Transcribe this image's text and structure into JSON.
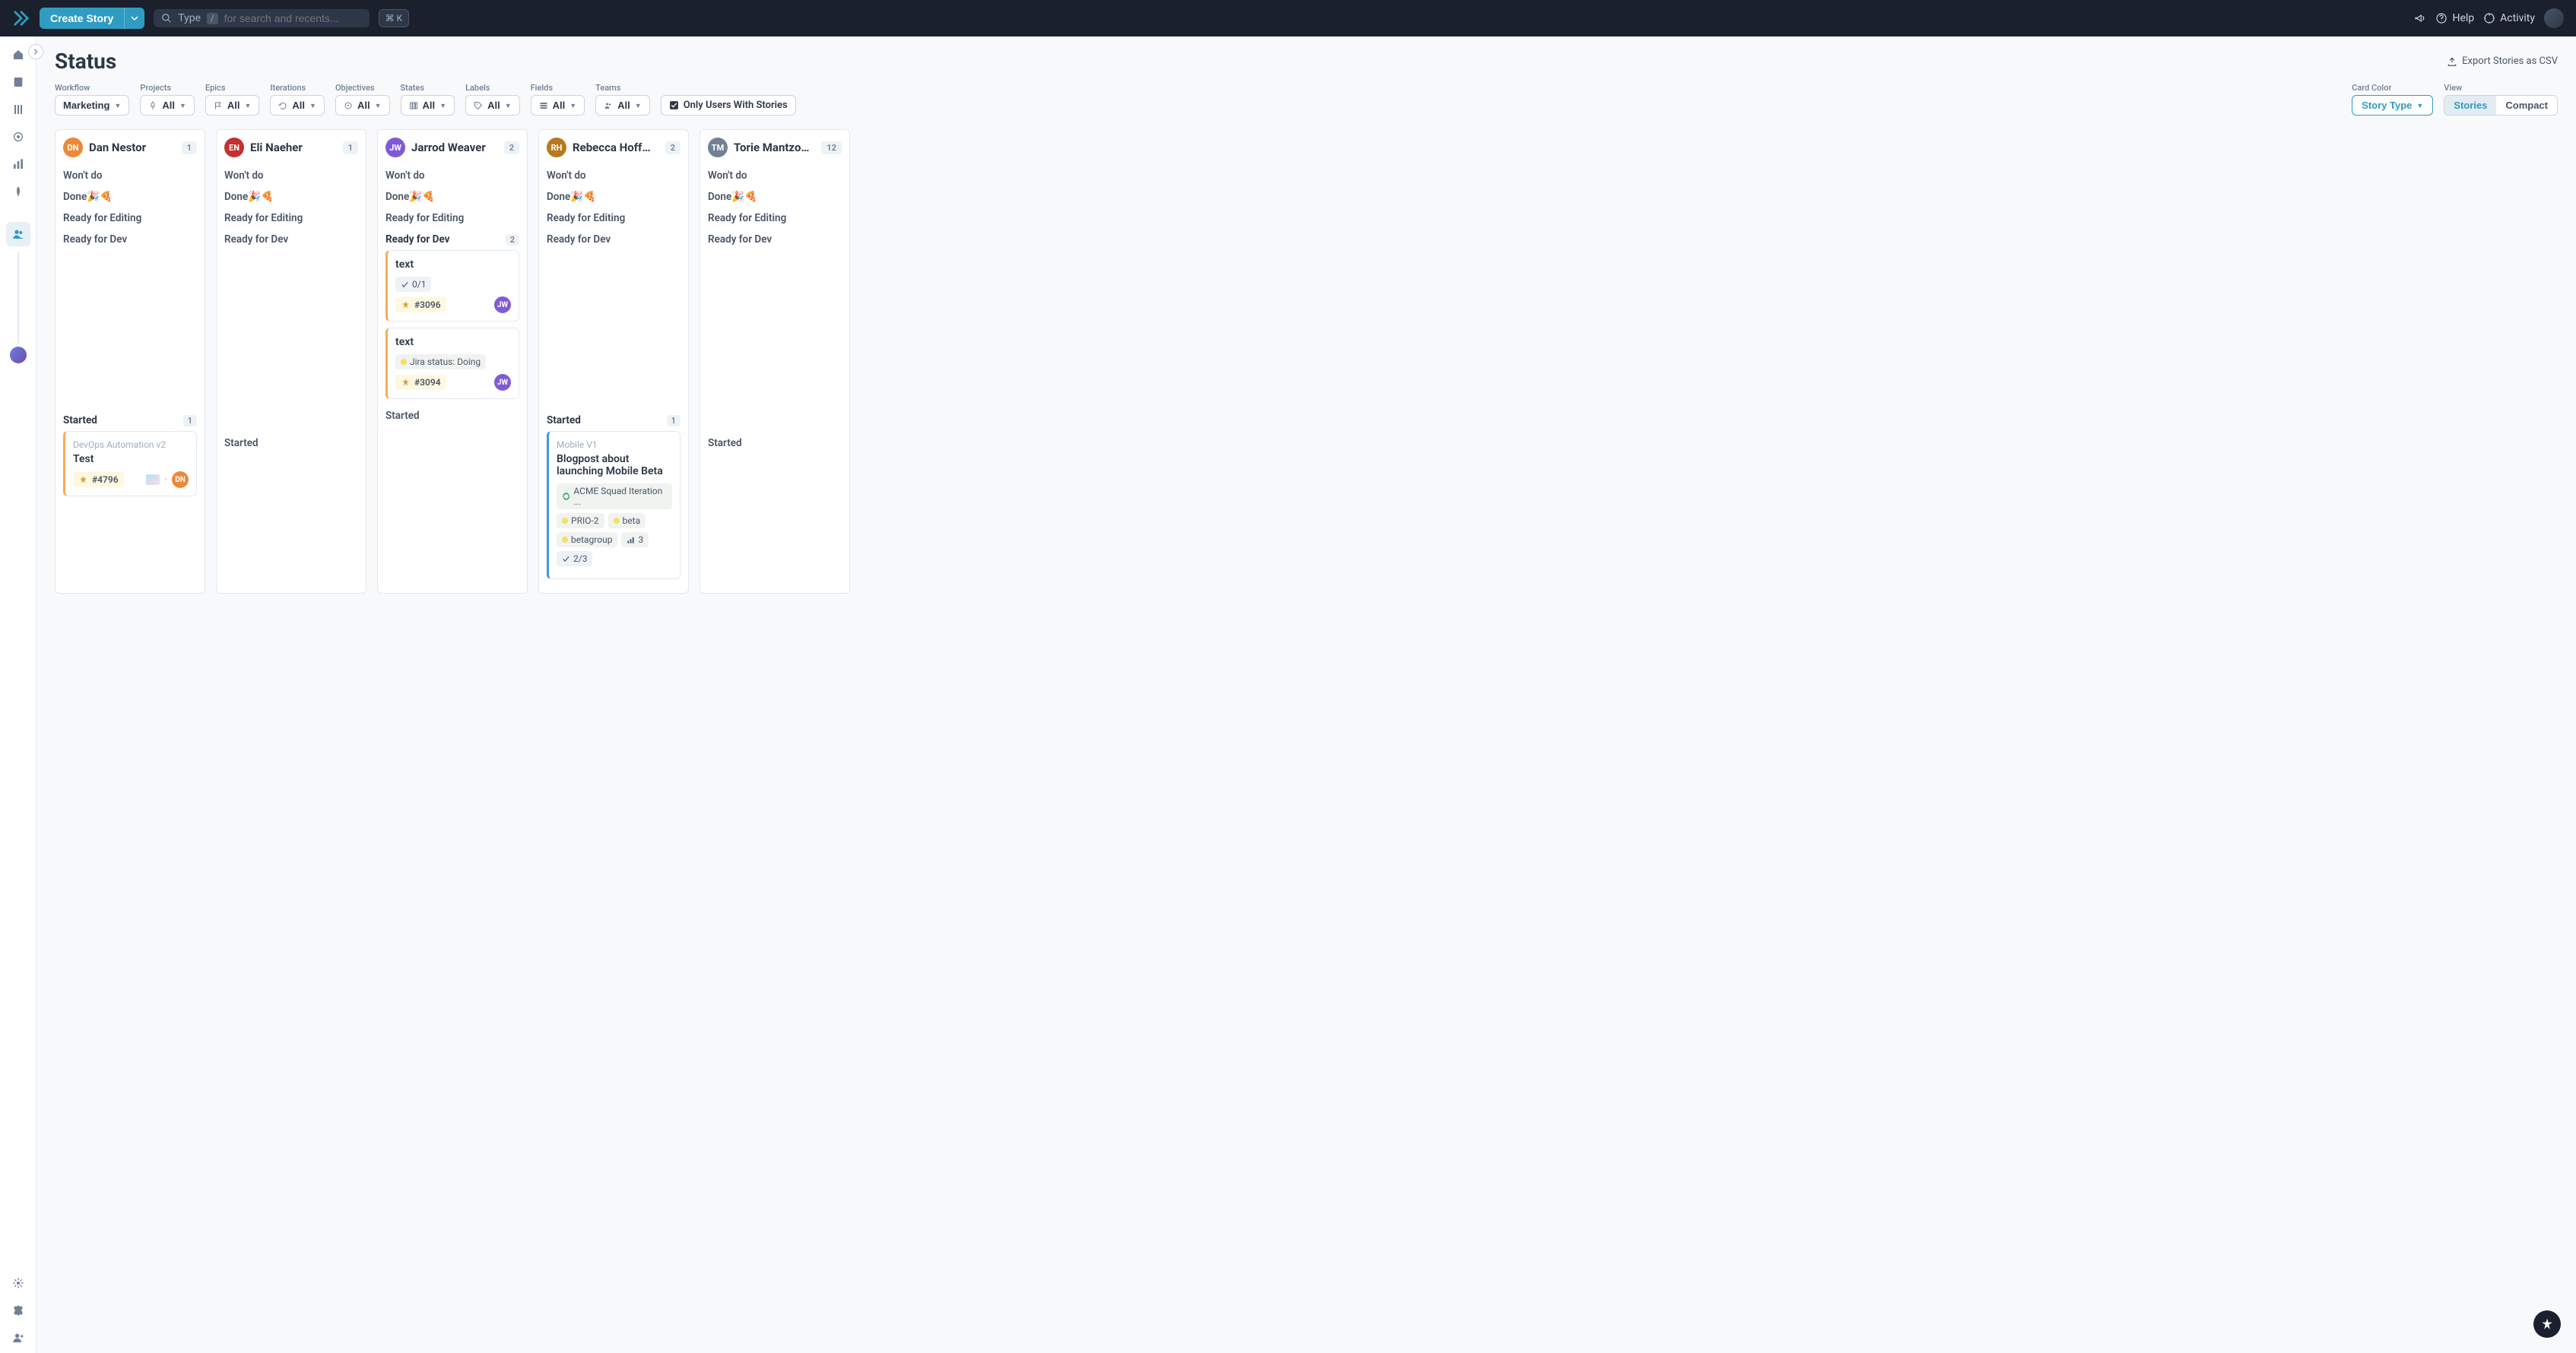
{
  "topbar": {
    "create_label": "Create Story",
    "search_prefix": "Type",
    "search_slash": "/",
    "search_placeholder": "for search and recents...",
    "cmd_k": "⌘ K",
    "help_label": "Help",
    "activity_label": "Activity"
  },
  "page": {
    "title": "Status",
    "export_label": "Export Stories as CSV"
  },
  "filters": {
    "workflow": {
      "label": "Workflow",
      "value": "Marketing"
    },
    "projects": {
      "label": "Projects",
      "value": "All"
    },
    "epics": {
      "label": "Epics",
      "value": "All"
    },
    "iterations": {
      "label": "Iterations",
      "value": "All"
    },
    "objectives": {
      "label": "Objectives",
      "value": "All"
    },
    "states": {
      "label": "States",
      "value": "All"
    },
    "labels": {
      "label": "Labels",
      "value": "All"
    },
    "fields": {
      "label": "Fields",
      "value": "All"
    },
    "teams": {
      "label": "Teams",
      "value": "All"
    },
    "only_users": "Only Users With Stories",
    "card_color_label": "Card Color",
    "card_color_value": "Story Type",
    "view_label": "View",
    "view_stories": "Stories",
    "view_compact": "Compact"
  },
  "sections": {
    "wont_do": "Won't do",
    "done": "Done🎉🍕",
    "ready_editing": "Ready for Editing",
    "ready_dev": "Ready for Dev",
    "started": "Started"
  },
  "columns": [
    {
      "name": "Dan Nestor",
      "initials": "DN",
      "color": "#ed8936",
      "count": "1",
      "started_count": "1",
      "started_cards": [
        {
          "epic": "DevOps Automation v2",
          "title": "Test",
          "id": "#4796",
          "edge": "orange",
          "mail": true,
          "assignee_initials": "DN",
          "assignee_color": "#ed8936"
        }
      ]
    },
    {
      "name": "Eli Naeher",
      "initials": "EN",
      "color": "#c53030",
      "count": "1"
    },
    {
      "name": "Jarrod Weaver",
      "initials": "JW",
      "color": "#805ad5",
      "count": "2",
      "ready_dev_count": "2",
      "ready_dev_cards": [
        {
          "title": "text",
          "tasks": "0/1",
          "id": "#3096",
          "edge": "orange",
          "assignee_initials": "JW",
          "assignee_color": "#805ad5"
        },
        {
          "title": "text",
          "jira": "Jira status: Doing",
          "id": "#3094",
          "edge": "orange",
          "assignee_initials": "JW",
          "assignee_color": "#805ad5"
        }
      ]
    },
    {
      "name": "Rebecca Hoffman",
      "initials": "RH",
      "color": "#b7791f",
      "count": "2",
      "started_count": "1",
      "started_cards": [
        {
          "epic": "Mobile V1",
          "title": "Blogpost about launching Mobile Beta",
          "edge": "blue",
          "iteration": "ACME Squad Iteration ...",
          "labels": [
            "PRIO-2",
            "beta",
            "betagroup"
          ],
          "points": "3",
          "tasks": "2/3"
        }
      ]
    },
    {
      "name": "Torie Mantzour...",
      "initials": "TM",
      "color": "#718096",
      "count": "12"
    }
  ]
}
